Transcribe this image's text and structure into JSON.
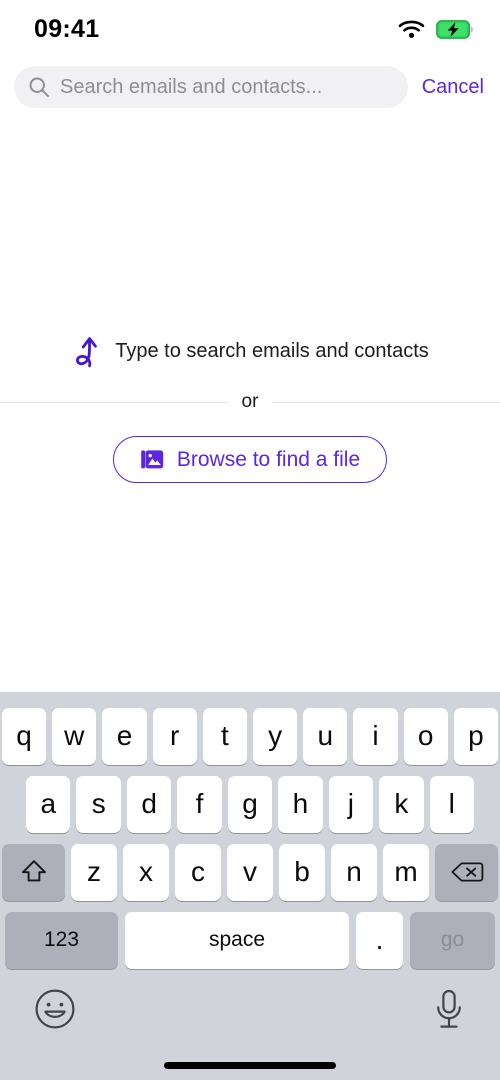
{
  "status_bar": {
    "time": "09:41",
    "wifi_icon": "wifi-icon",
    "battery_icon": "battery-charging-icon",
    "battery_color": "#33d15f"
  },
  "search": {
    "icon": "search-icon",
    "placeholder": "Search emails and contacts...",
    "value": "",
    "cancel_label": "Cancel"
  },
  "empty_state": {
    "arrow_icon": "curly-arrow-up-icon",
    "message": "Type to search emails and contacts",
    "divider_label": "or",
    "browse_icon": "photo-library-icon",
    "browse_label": "Browse to find a file"
  },
  "theme": {
    "accent": "#5d26df",
    "text": "#1b1b20",
    "placeholder": "#8d8d94",
    "field_bg": "#f1f1f4",
    "keyboard_bg": "#d1d3da",
    "key_bg": "#ffffff",
    "key_dark_bg": "#adb0ba"
  },
  "keyboard": {
    "row1": [
      "q",
      "w",
      "e",
      "r",
      "t",
      "y",
      "u",
      "i",
      "o",
      "p"
    ],
    "row2": [
      "a",
      "s",
      "d",
      "f",
      "g",
      "h",
      "j",
      "k",
      "l"
    ],
    "row3": [
      "z",
      "x",
      "c",
      "v",
      "b",
      "n",
      "m"
    ],
    "shift_icon": "shift-arrow-up-icon",
    "backspace_icon": "backspace-delete-icon",
    "numbers_label": "123",
    "space_label": "space",
    "period_label": ".",
    "return_label": "go",
    "emoji_icon": "emoji-smiley-icon",
    "dictation_icon": "microphone-icon"
  }
}
